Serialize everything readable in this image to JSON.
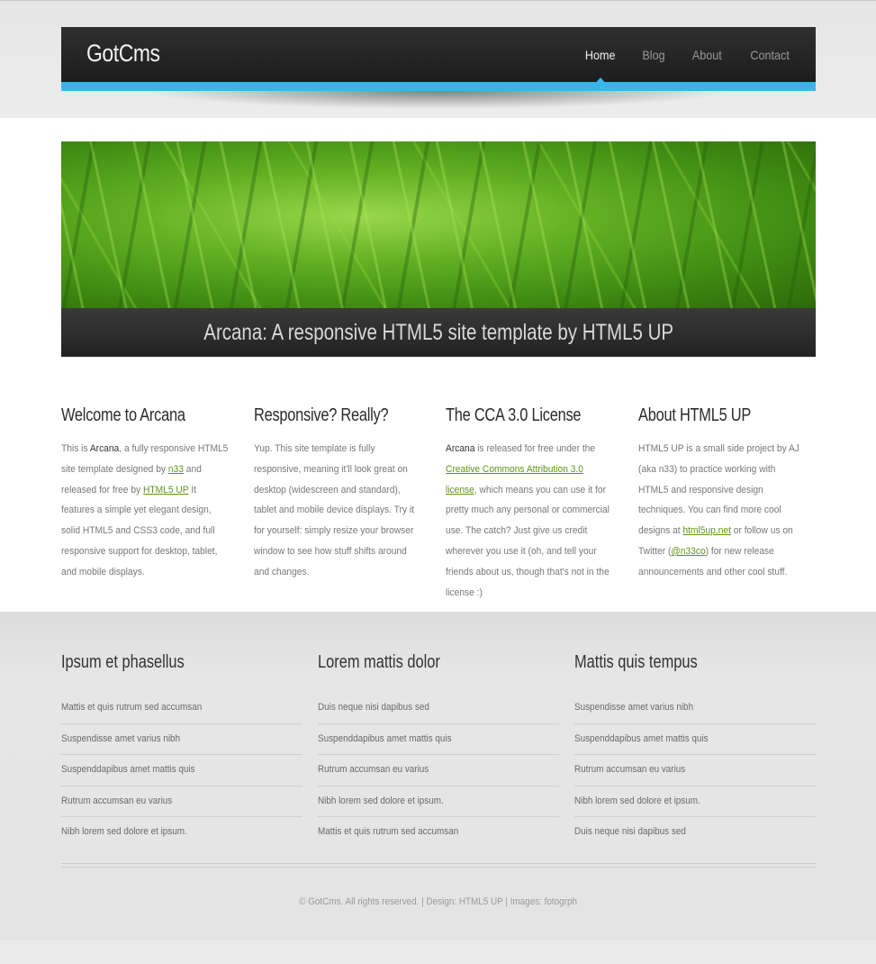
{
  "site": {
    "title": "GotCms"
  },
  "nav": {
    "items": [
      "Home",
      "Blog",
      "About",
      "Contact"
    ],
    "active_index": 0
  },
  "banner": {
    "caption": "Arcana: A responsive HTML5 site template by HTML5 UP"
  },
  "colors": {
    "accent": "#3ab5ec",
    "link": "#5e9416",
    "header_bg": "#222222"
  },
  "columns": [
    {
      "title": "Welcome to Arcana",
      "parts": [
        {
          "t": "This is "
        },
        {
          "b": "Arcana"
        },
        {
          "t": ", a fully responsive HTML5 site template designed by "
        },
        {
          "a": "n33"
        },
        {
          "t": " and released for free by "
        },
        {
          "a": "HTML5 UP"
        },
        {
          "t": " It features a simple yet elegant design, solid HTML5 and CSS3 code, and full responsive support for desktop, tablet, and mobile displays."
        }
      ]
    },
    {
      "title": "Responsive? Really?",
      "parts": [
        {
          "t": "Yup. This site template is fully responsive, meaning it'll look great on desktop (widescreen and standard), tablet and mobile device displays. Try it for yourself: simply resize your browser window to see how stuff shifts around and changes."
        }
      ]
    },
    {
      "title": "The CCA 3.0 License",
      "parts": [
        {
          "b": "Arcana"
        },
        {
          "t": " is released for free under the "
        },
        {
          "a": "Creative Commons Attribution 3.0 license"
        },
        {
          "t": ", which means you can use it for pretty much any personal or commercial use. The catch? Just give us credit wherever you use it (oh, and tell your friends about us, though that's not in the license :)"
        }
      ]
    },
    {
      "title": "About HTML5 UP",
      "parts": [
        {
          "t": "HTML5 UP is a small side project by AJ (aka n33) to practice working with HTML5 and responsive design techniques. You can find more cool designs at "
        },
        {
          "a": "html5up.net"
        },
        {
          "t": " or follow us on Twitter ("
        },
        {
          "a": "@n33co"
        },
        {
          "t": ") for new release announcements and other cool stuff."
        }
      ]
    }
  ],
  "footer_columns": [
    {
      "title": "Ipsum et phasellus",
      "links": [
        "Mattis et quis rutrum sed accumsan",
        "Suspendisse amet varius nibh",
        "Suspenddapibus amet mattis quis",
        "Rutrum accumsan eu varius",
        "Nibh lorem sed dolore et ipsum."
      ]
    },
    {
      "title": "Lorem mattis dolor",
      "links": [
        "Duis neque nisi dapibus sed",
        "Suspenddapibus amet mattis quis",
        "Rutrum accumsan eu varius",
        "Nibh lorem sed dolore et ipsum.",
        "Mattis et quis rutrum sed accumsan"
      ]
    },
    {
      "title": "Mattis quis tempus",
      "links": [
        "Suspendisse amet varius nibh",
        "Suspenddapibus amet mattis quis",
        "Rutrum accumsan eu varius",
        "Nibh lorem sed dolore et ipsum.",
        "Duis neque nisi dapibus sed"
      ]
    }
  ],
  "copyright": "© GotCms. All rights reserved. | Design: HTML5 UP | Images: fotogrph"
}
